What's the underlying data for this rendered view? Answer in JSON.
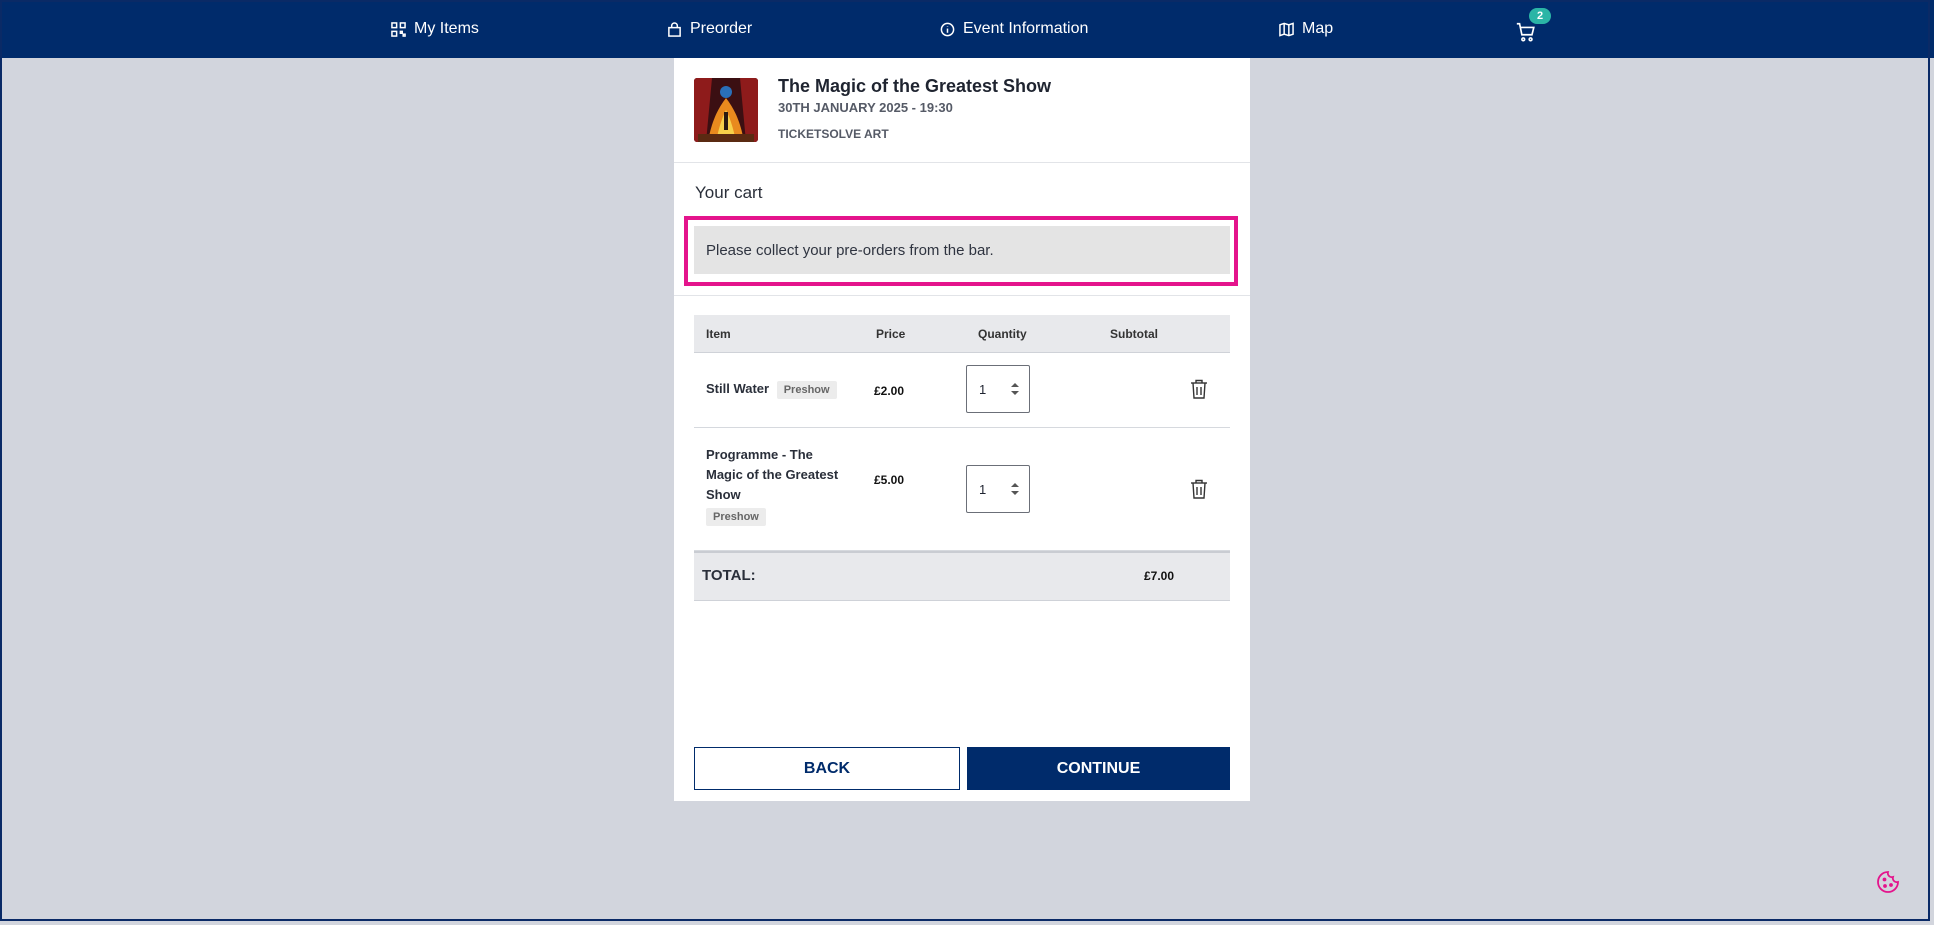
{
  "nav": {
    "items": [
      {
        "label": "My Items",
        "icon": "qr-code-icon"
      },
      {
        "label": "Preorder",
        "icon": "bag-icon"
      },
      {
        "label": "Event Information",
        "icon": "info-icon"
      },
      {
        "label": "Map",
        "icon": "map-icon"
      }
    ],
    "cart_count": "2"
  },
  "event": {
    "title": "The Magic of the Greatest Show",
    "date": "30TH JANUARY 2025 - 19:30",
    "venue": "TICKETSOLVE ART"
  },
  "cart": {
    "title": "Your cart",
    "notice": "Please collect your pre-orders from the bar.",
    "columns": [
      "Item",
      "Price",
      "Quantity",
      "Subtotal"
    ],
    "rows": [
      {
        "name": "Still Water",
        "tag": "Preshow",
        "price": "£2.00",
        "quantity": "1"
      },
      {
        "name_lines": [
          "Programme - The",
          "Magic of the Greatest",
          "Show"
        ],
        "tag": "Preshow",
        "price": "£5.00",
        "quantity": "1"
      }
    ],
    "total_label": "TOTAL:",
    "total_value": "£7.00"
  },
  "buttons": {
    "back": "BACK",
    "continue": "CONTINUE"
  },
  "colors": {
    "nav_bg": "#002b6b",
    "accent_pink": "#e4148c",
    "badge": "#2bb5a6",
    "page_bg": "#d2d5dd"
  }
}
